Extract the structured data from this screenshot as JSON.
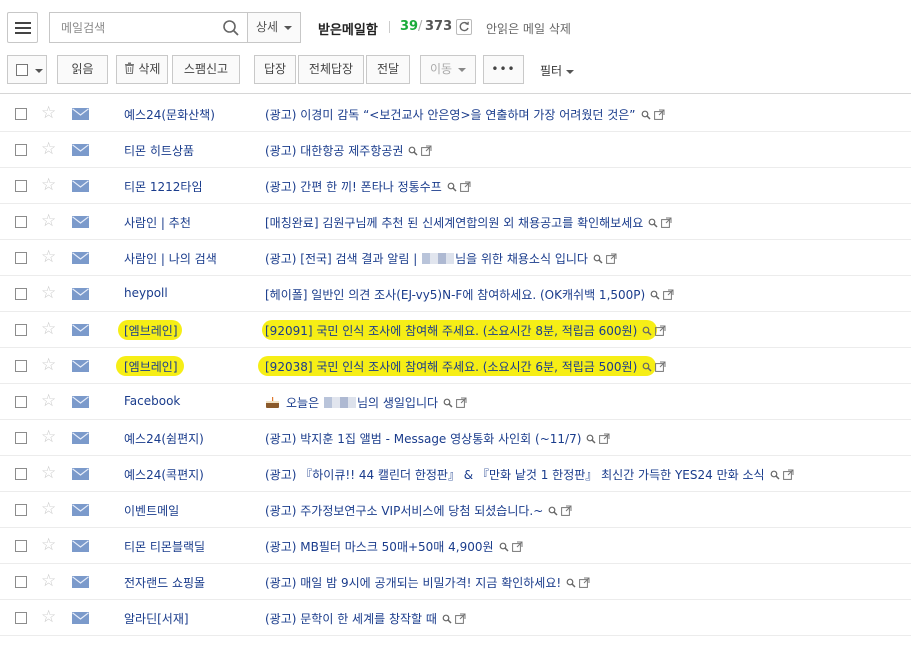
{
  "header": {
    "search_placeholder": "메일검색",
    "detail_label": "상세",
    "folder_title": "받은메일함",
    "unread_count": "39",
    "slash": "/",
    "total_count": "373",
    "delete_unread_label": "안읽은 메일 삭제"
  },
  "toolbar": {
    "read": "읽음",
    "delete": "삭제",
    "spam": "스팸신고",
    "reply": "답장",
    "reply_all": "전체답장",
    "forward": "전달",
    "move": "이동",
    "more": "•••",
    "filter": "필터"
  },
  "colors": {
    "sender_text": "#1a3c8c",
    "unread_count": "#1aab3a",
    "highlight": "#f6ee16"
  },
  "mails": [
    {
      "sender": "예스24(문화산책)",
      "subject": "(광고) 이경미 감독 “<보건교사 안은영>을 연출하며 가장 어려웠던 것은”"
    },
    {
      "sender": "티몬 히트상품",
      "subject": "(광고) 대한항공 제주항공권"
    },
    {
      "sender": "티몬 1212타임",
      "subject": "(광고) 간편 한 끼! 폰타나 정통수프"
    },
    {
      "sender": "사람인 | 추천",
      "subject": "[매칭완료] 김원구님께 추천 된 신세계연합의원 외 채용공고를 확인해보세요"
    },
    {
      "sender": "사람인 | 나의 검색",
      "subject_before": "(광고) [전국] 검색 결과 알림 | ",
      "subject_after": "님을 위한 채용소식 입니다"
    },
    {
      "sender": "heypoll",
      "subject": "[헤이폴] 일반인 의견 조사(EJ-vy5)N-F에 참여하세요. (OK캐쉬백 1,500P)"
    },
    {
      "sender": "[엠브레인]",
      "subject": "[92091] 국민 인식 조사에 참여해 주세요. (소요시간 8분, 적립금 600원)"
    },
    {
      "sender": "[엠브레인]",
      "subject": "[92038] 국민 인식 조사에 참여해 주세요. (소요시간 6분, 적립금 500원)"
    },
    {
      "sender": "Facebook",
      "subject_before": "오늘은 ",
      "subject_after": "님의 생일입니다"
    },
    {
      "sender": "예스24(쉼편지)",
      "subject": "(광고) 박지훈 1집 앨범 - Message 영상통화 사인회 (~11/7)"
    },
    {
      "sender": "예스24(콕편지)",
      "subject": "(광고) 『하이큐!! 44 캘린더 한정판』 & 『만화 낱것 1 한정판』 최신간 가득한 YES24 만화 소식"
    },
    {
      "sender": "이벤트메일",
      "subject": "(광고) 주가정보연구소 VIP서비스에 당첨 되셨습니다.~"
    },
    {
      "sender": "티몬 티몬블랙딜",
      "subject": "(광고) MB필터 마스크 50매+50매 4,900원"
    },
    {
      "sender": "전자랜드 쇼핑몰",
      "subject": "(광고) 매일 밤 9시에 공개되는 비밀가격! 지금 확인하세요!"
    },
    {
      "sender": "알라딘[서재]",
      "subject": "(광고) 문학이 한 세계를 창작할 때"
    }
  ]
}
